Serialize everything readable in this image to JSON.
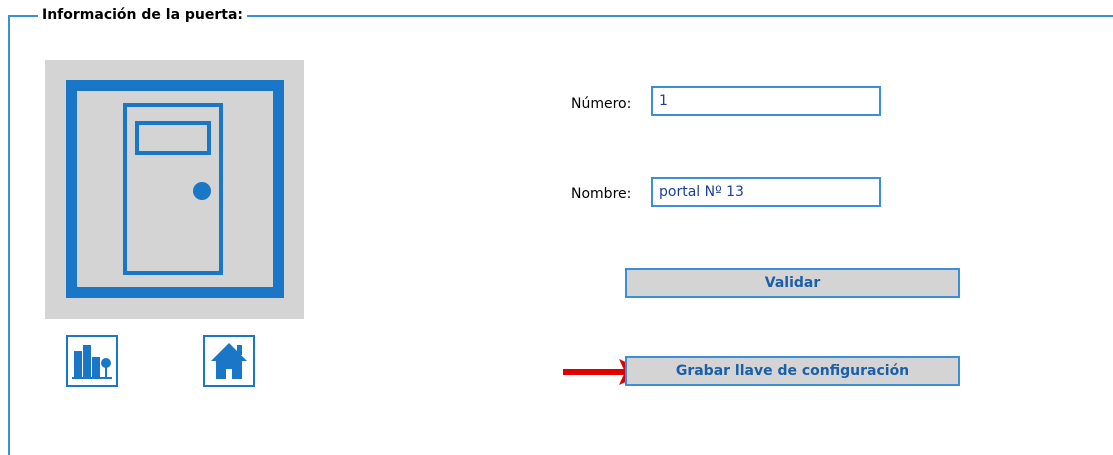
{
  "section": {
    "legend": "Información de la puerta:"
  },
  "door_image": {
    "icon": "door-icon",
    "colors": {
      "panel": "#d4d4d4",
      "frame": "#1a76c7"
    }
  },
  "nav": [
    {
      "icon": "buildings-icon"
    },
    {
      "icon": "home-icon"
    }
  ],
  "form": {
    "numero": {
      "label": "Número:",
      "value": "1"
    },
    "nombre": {
      "label": "Nombre:",
      "value": "portal Nº 13"
    }
  },
  "buttons": {
    "validar": "Validar",
    "grabar": "Grabar llave de configuración"
  },
  "annotation": {
    "icon": "red-arrow-icon",
    "color": "#e00000"
  },
  "colors": {
    "accent": "#3b8fd9",
    "button_bg": "#d4d4d4",
    "button_text": "#1a5fa8"
  }
}
